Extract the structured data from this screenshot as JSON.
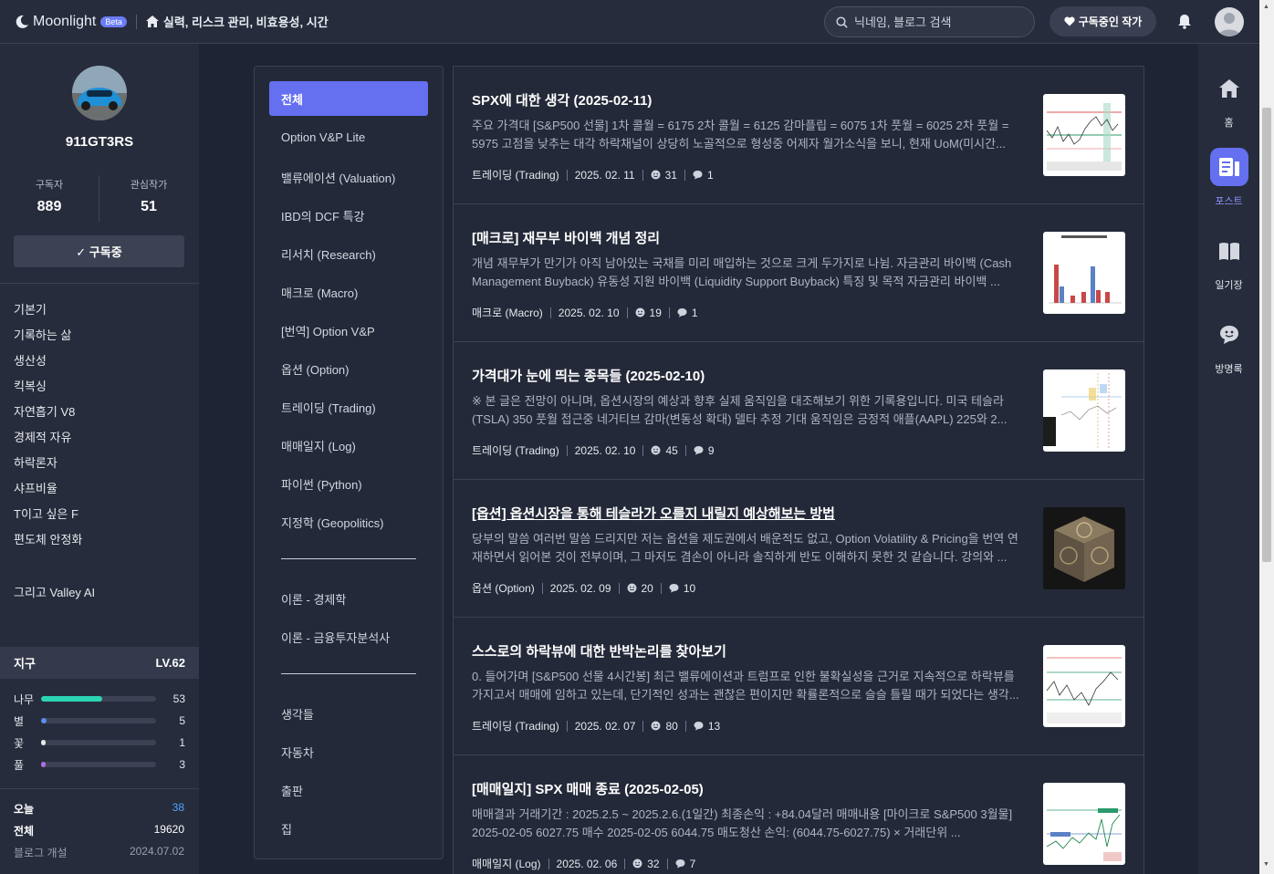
{
  "header": {
    "logo": "Moonlight",
    "beta": "Beta",
    "breadcrumb": "실력, 리스크 관리, 비효용성, 시간",
    "search_placeholder": "닉네임, 블로그 검색",
    "subscribed_authors": "구독중인 작가"
  },
  "profile": {
    "name": "911GT3RS",
    "subscribers_label": "구독자",
    "subscribers": "889",
    "interest_label": "관심작가",
    "interest": "51",
    "follow_button": "✓ 구독중"
  },
  "sidebar_categories": [
    "기본기",
    "기록하는 삶",
    "생산성",
    "킥복싱",
    "자연흡기 V8",
    "경제적 자유",
    "하락론자",
    "샤프비율",
    "T이고 싶은 F",
    "편도체 안정화"
  ],
  "sidebar_extra": "그리고 Valley AI",
  "level": {
    "name": "지구",
    "level": "LV.62",
    "stats": [
      {
        "name": "나무",
        "value": "53",
        "fraction": 0.53,
        "color": "#2dd4b4"
      },
      {
        "name": "별",
        "value": "5",
        "fraction": 0.05,
        "color": "#5b8cf0"
      },
      {
        "name": "꽃",
        "value": "1",
        "fraction": 0.01,
        "color": "#e8e8e8"
      },
      {
        "name": "풀",
        "value": "3",
        "fraction": 0.03,
        "color": "#b06ce8"
      }
    ]
  },
  "visits": {
    "today_label": "오늘",
    "today": "38",
    "total_label": "전체",
    "total": "19620",
    "opened_label": "블로그 개설",
    "opened": "2024.07.02"
  },
  "menu": {
    "all": "전체",
    "items": [
      "Option V&P Lite",
      "밸류에이션 (Valuation)",
      "IBD의 DCF 특강",
      "리서치 (Research)",
      "매크로 (Macro)",
      "[번역] Option V&P",
      "옵션 (Option)",
      "트레이딩 (Trading)",
      "매매일지 (Log)",
      "파이썬 (Python)",
      "지정학 (Geopolitics)"
    ],
    "theory": [
      "이론 - 경제학",
      "이론 - 금융투자분석사"
    ],
    "misc": [
      "생각들",
      "자동차",
      "출판",
      "집"
    ]
  },
  "posts": [
    {
      "title": "SPX에 대한 생각 (2025-02-11)",
      "body": "주요 가격대 [S&P500 선물] 1차 콜월 = 6175 2차 콜월 = 6125 감마플립 = 6075 1차 풋월 = 6025 2차 풋월 = 5975 고점을 낮추는 대각 하락채널이 상당히 노골적으로 형성중 어제자 월가소식을 보니, 현재 UoM(미시간...",
      "category": "트레이딩 (Trading)",
      "date": "2025. 02. 11",
      "likes": "31",
      "comments": "1"
    },
    {
      "title": "[매크로] 재무부 바이백 개념 정리",
      "body": "개념 재무부가 만기가 아직 남아있는 국채를 미리 매입하는 것으로 크게 두가지로 나뉨. 자금관리 바이백 (Cash Management Buyback) 유동성 지원 바이백 (Liquidity Support Buyback) 특징 및 목적 자금관리 바이백 ...",
      "category": "매크로 (Macro)",
      "date": "2025. 02. 10",
      "likes": "19",
      "comments": "1"
    },
    {
      "title": "가격대가 눈에 띄는 종목들 (2025-02-10)",
      "body": "※ 본 글은 전망이 아니며, 옵션시장의 예상과 향후 실제 움직임을 대조해보기 위한 기록용입니다. 미국 테슬라 (TSLA) 350 풋월 접근중 네거티브 감마(변동성 확대) 델타 추정 기대 움직임은 긍정적 애플(AAPL) 225와 2...",
      "category": "트레이딩 (Trading)",
      "date": "2025. 02. 10",
      "likes": "45",
      "comments": "9"
    },
    {
      "title": "[옵션] 옵션시장을 통해 테슬라가 오를지 내릴지 예상해보는 방법",
      "body": "당부의 말씀 여러번 말씀 드리지만 저는 옵션을 제도권에서 배운적도 없고, Option Volatility & Pricing을 번역 연재하면서 읽어본 것이 전부이며, 그 마저도 겸손이 아니라 솔직하게 반도 이해하지 못한 것 같습니다. 강의와 ...",
      "category": "옵션 (Option)",
      "date": "2025. 02. 09",
      "likes": "20",
      "comments": "10"
    },
    {
      "title": "스스로의 하락뷰에 대한 반박논리를 찾아보기",
      "body": "0. 들어가며 [S&P500 선물 4시간봉] 최근 밸류에이션과 트럼프로 인한 불확실성을 근거로 지속적으로 하락뷰를 가지고서 매매에 임하고 있는데, 단기적인 성과는 괜찮은 편이지만 확률론적으로 슬슬 틀릴 때가 되었다는 생각...",
      "category": "트레이딩 (Trading)",
      "date": "2025. 02. 07",
      "likes": "80",
      "comments": "13"
    },
    {
      "title": "[매매일지] SPX 매매 종료 (2025-02-05)",
      "body": "매매결과 거래기간 : 2025.2.5 ~ 2025.2.6.(1일간) 최종손익 : +84.04달러 매매내용 [마이크로 S&P500 3월물] 2025-02-05 6027.75 매수 2025-02-05 6044.75 매도청산 손익: (6044.75-6027.75) × 거래단위 ...",
      "category": "매매일지 (Log)",
      "date": "2025. 02. 06",
      "likes": "32",
      "comments": "7"
    }
  ],
  "rightnav": {
    "home": "홈",
    "posts": "포스트",
    "diary": "일기장",
    "guestbook": "방명록"
  }
}
